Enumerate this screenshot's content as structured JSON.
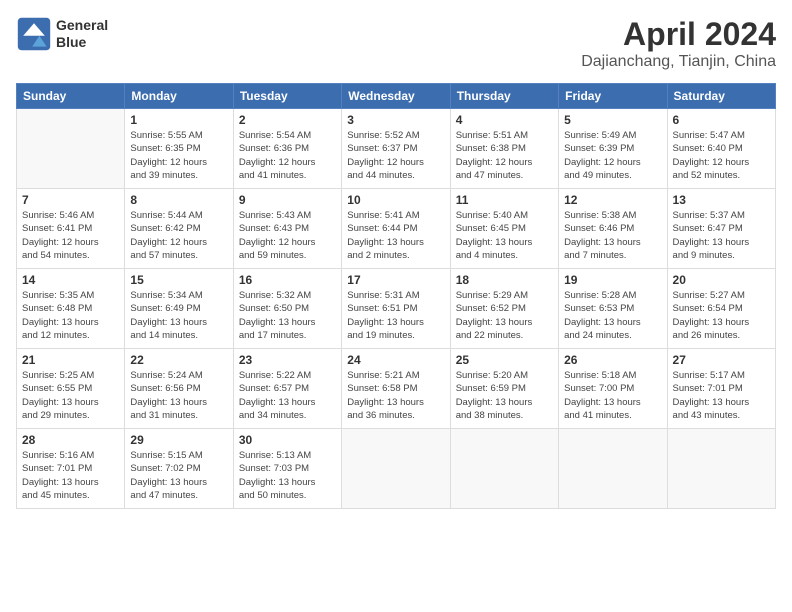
{
  "header": {
    "logo_line1": "General",
    "logo_line2": "Blue",
    "month": "April 2024",
    "location": "Dajianchang, Tianjin, China"
  },
  "days_of_week": [
    "Sunday",
    "Monday",
    "Tuesday",
    "Wednesday",
    "Thursday",
    "Friday",
    "Saturday"
  ],
  "weeks": [
    [
      {
        "day": "",
        "info": ""
      },
      {
        "day": "1",
        "info": "Sunrise: 5:55 AM\nSunset: 6:35 PM\nDaylight: 12 hours\nand 39 minutes."
      },
      {
        "day": "2",
        "info": "Sunrise: 5:54 AM\nSunset: 6:36 PM\nDaylight: 12 hours\nand 41 minutes."
      },
      {
        "day": "3",
        "info": "Sunrise: 5:52 AM\nSunset: 6:37 PM\nDaylight: 12 hours\nand 44 minutes."
      },
      {
        "day": "4",
        "info": "Sunrise: 5:51 AM\nSunset: 6:38 PM\nDaylight: 12 hours\nand 47 minutes."
      },
      {
        "day": "5",
        "info": "Sunrise: 5:49 AM\nSunset: 6:39 PM\nDaylight: 12 hours\nand 49 minutes."
      },
      {
        "day": "6",
        "info": "Sunrise: 5:47 AM\nSunset: 6:40 PM\nDaylight: 12 hours\nand 52 minutes."
      }
    ],
    [
      {
        "day": "7",
        "info": "Sunrise: 5:46 AM\nSunset: 6:41 PM\nDaylight: 12 hours\nand 54 minutes."
      },
      {
        "day": "8",
        "info": "Sunrise: 5:44 AM\nSunset: 6:42 PM\nDaylight: 12 hours\nand 57 minutes."
      },
      {
        "day": "9",
        "info": "Sunrise: 5:43 AM\nSunset: 6:43 PM\nDaylight: 12 hours\nand 59 minutes."
      },
      {
        "day": "10",
        "info": "Sunrise: 5:41 AM\nSunset: 6:44 PM\nDaylight: 13 hours\nand 2 minutes."
      },
      {
        "day": "11",
        "info": "Sunrise: 5:40 AM\nSunset: 6:45 PM\nDaylight: 13 hours\nand 4 minutes."
      },
      {
        "day": "12",
        "info": "Sunrise: 5:38 AM\nSunset: 6:46 PM\nDaylight: 13 hours\nand 7 minutes."
      },
      {
        "day": "13",
        "info": "Sunrise: 5:37 AM\nSunset: 6:47 PM\nDaylight: 13 hours\nand 9 minutes."
      }
    ],
    [
      {
        "day": "14",
        "info": "Sunrise: 5:35 AM\nSunset: 6:48 PM\nDaylight: 13 hours\nand 12 minutes."
      },
      {
        "day": "15",
        "info": "Sunrise: 5:34 AM\nSunset: 6:49 PM\nDaylight: 13 hours\nand 14 minutes."
      },
      {
        "day": "16",
        "info": "Sunrise: 5:32 AM\nSunset: 6:50 PM\nDaylight: 13 hours\nand 17 minutes."
      },
      {
        "day": "17",
        "info": "Sunrise: 5:31 AM\nSunset: 6:51 PM\nDaylight: 13 hours\nand 19 minutes."
      },
      {
        "day": "18",
        "info": "Sunrise: 5:29 AM\nSunset: 6:52 PM\nDaylight: 13 hours\nand 22 minutes."
      },
      {
        "day": "19",
        "info": "Sunrise: 5:28 AM\nSunset: 6:53 PM\nDaylight: 13 hours\nand 24 minutes."
      },
      {
        "day": "20",
        "info": "Sunrise: 5:27 AM\nSunset: 6:54 PM\nDaylight: 13 hours\nand 26 minutes."
      }
    ],
    [
      {
        "day": "21",
        "info": "Sunrise: 5:25 AM\nSunset: 6:55 PM\nDaylight: 13 hours\nand 29 minutes."
      },
      {
        "day": "22",
        "info": "Sunrise: 5:24 AM\nSunset: 6:56 PM\nDaylight: 13 hours\nand 31 minutes."
      },
      {
        "day": "23",
        "info": "Sunrise: 5:22 AM\nSunset: 6:57 PM\nDaylight: 13 hours\nand 34 minutes."
      },
      {
        "day": "24",
        "info": "Sunrise: 5:21 AM\nSunset: 6:58 PM\nDaylight: 13 hours\nand 36 minutes."
      },
      {
        "day": "25",
        "info": "Sunrise: 5:20 AM\nSunset: 6:59 PM\nDaylight: 13 hours\nand 38 minutes."
      },
      {
        "day": "26",
        "info": "Sunrise: 5:18 AM\nSunset: 7:00 PM\nDaylight: 13 hours\nand 41 minutes."
      },
      {
        "day": "27",
        "info": "Sunrise: 5:17 AM\nSunset: 7:01 PM\nDaylight: 13 hours\nand 43 minutes."
      }
    ],
    [
      {
        "day": "28",
        "info": "Sunrise: 5:16 AM\nSunset: 7:01 PM\nDaylight: 13 hours\nand 45 minutes."
      },
      {
        "day": "29",
        "info": "Sunrise: 5:15 AM\nSunset: 7:02 PM\nDaylight: 13 hours\nand 47 minutes."
      },
      {
        "day": "30",
        "info": "Sunrise: 5:13 AM\nSunset: 7:03 PM\nDaylight: 13 hours\nand 50 minutes."
      },
      {
        "day": "",
        "info": ""
      },
      {
        "day": "",
        "info": ""
      },
      {
        "day": "",
        "info": ""
      },
      {
        "day": "",
        "info": ""
      }
    ]
  ]
}
